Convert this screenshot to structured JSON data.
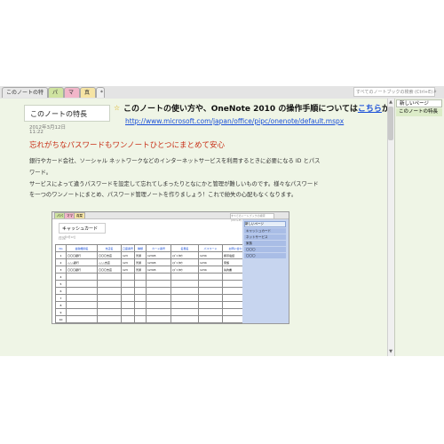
{
  "tabs": [
    {
      "label": "このノートの特長",
      "color": "#e8e8e8"
    },
    {
      "label": "パパ",
      "color": "#cfe3a0"
    },
    {
      "label": "ママ",
      "color": "#f2b6c9"
    },
    {
      "label": "真栞",
      "color": "#f6e4a4"
    }
  ],
  "search": {
    "placeholder": "すべてのノートブックの検索 (Ctrl+E)"
  },
  "page": {
    "title": "このノートの特長",
    "date": "2012年3月12日",
    "time": "11:22",
    "headline_prefix": "このノートの使い方や、OneNote 2010 の操作手順については",
    "headline_link": "こちら",
    "headline_suffix": "から",
    "url": "http://www.microsoft.com/japan/office/pipc/onenote/default.mspx",
    "red_heading": "忘れがちなパスワードもワンノートひとつにまとめて安心",
    "paragraph": [
      "銀行やカード会社、ソーシャル ネットワークなどのインターネットサービスを利用するときに必要になる ID とパス",
      "ワード。",
      "サービスによって違うパスワードを設定して忘れてしまったりとなにかと管理が難しいものです。様々なパスワード",
      "を一つのワンノートにまとめ、パスワード管理ノートを作りましょう！これで紛失の心配もなくなります。"
    ]
  },
  "embedded": {
    "tabs": [
      "パパ",
      "ママ",
      "真栞"
    ],
    "search": "すべてのノートブックの検索 (Ctrl+E)",
    "title": "キャッシュカード",
    "date": "2012年3月12日",
    "time": "11:28",
    "side_new": "新しいページ",
    "side_items": [
      "キャッシュカード",
      "ネットサービス",
      "家族",
      "〇〇〇",
      "〇〇〇"
    ],
    "table": {
      "headers": [
        "No",
        "金融機関名",
        "支店名",
        "口座番号",
        "種類",
        "カード番号",
        "名義名",
        "パスワード",
        "お問い合わせ"
      ],
      "rows": [
        [
          "1",
          "〇〇〇銀行",
          "〇〇〇支店",
          "123",
          "普通",
          "12345",
          "ｽｽﾞｷ ﾀﾛｳ",
          "1234",
          "携帯電話"
        ],
        [
          "2",
          "△△△銀行",
          "△△△支店",
          "123",
          "普通",
          "12345",
          "ｽｽﾞｷ ﾀﾛｳ",
          "1234",
          "家族"
        ],
        [
          "3",
          "〇〇〇銀行",
          "〇〇〇支店",
          "123",
          "普通",
          "12345",
          "ｽｽﾞｷ ﾀﾛｳ",
          "1234",
          "先約書"
        ],
        [
          "4",
          "",
          "",
          "",
          "",
          "",
          "",
          "",
          ""
        ],
        [
          "5",
          "",
          "",
          "",
          "",
          "",
          "",
          "",
          ""
        ],
        [
          "6",
          "",
          "",
          "",
          "",
          "",
          "",
          "",
          ""
        ],
        [
          "7",
          "",
          "",
          "",
          "",
          "",
          "",
          "",
          ""
        ],
        [
          "8",
          "",
          "",
          "",
          "",
          "",
          "",
          "",
          ""
        ],
        [
          "9",
          "",
          "",
          "",
          "",
          "",
          "",
          "",
          ""
        ],
        [
          "10",
          "",
          "",
          "",
          "",
          "",
          "",
          "",
          ""
        ]
      ]
    }
  },
  "pages_panel": {
    "new_page": "新しいページ",
    "items": [
      "このノートの特長"
    ]
  },
  "colors": {
    "link": "#1a4fd8",
    "red_heading": "#c83018",
    "page_bg": "#eff5e6"
  }
}
